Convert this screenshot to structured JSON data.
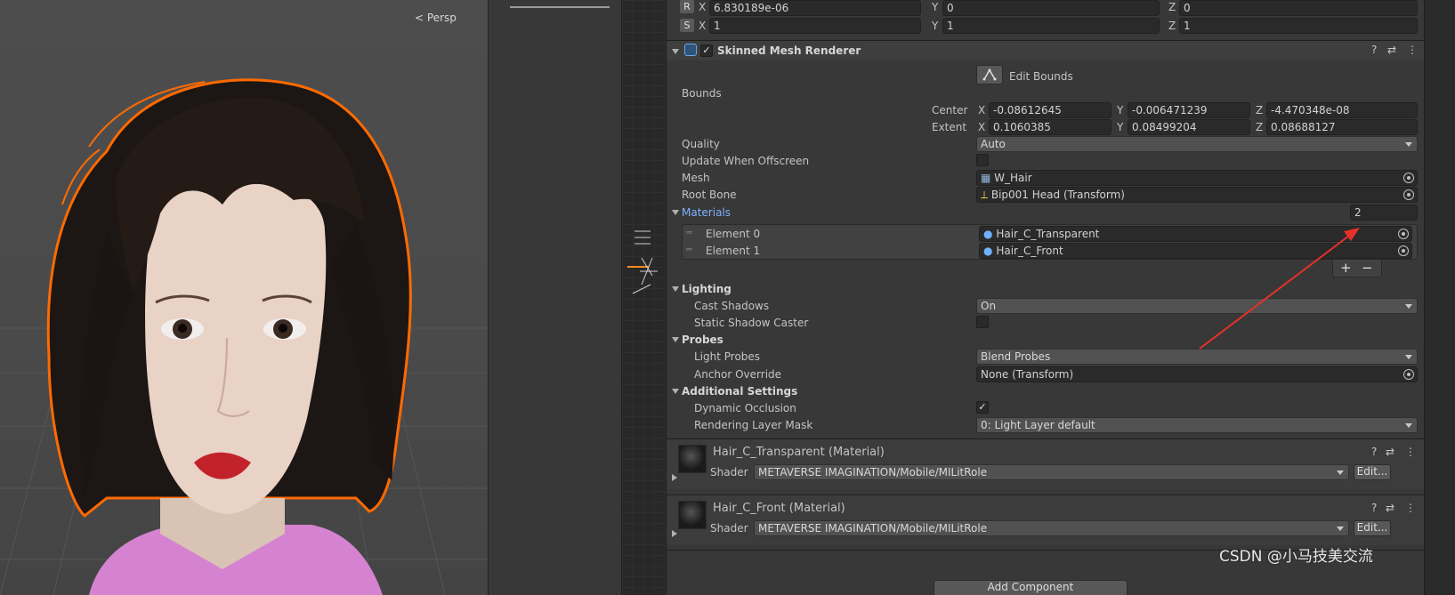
{
  "scene": {
    "view_mode": "Persp"
  },
  "transform": {
    "rotation": {
      "badge": "R",
      "x": "6.830189e-06",
      "y": "0",
      "z": "0"
    },
    "scale": {
      "badge": "S",
      "x": "1",
      "y": "1",
      "z": "1"
    },
    "axes": {
      "x": "X",
      "y": "Y",
      "z": "Z"
    }
  },
  "renderer": {
    "title": "Skinned Mesh Renderer",
    "edit_bounds_label": "Edit Bounds",
    "bounds_label": "Bounds",
    "center_label": "Center",
    "center": {
      "x": "-0.08612645",
      "y": "-0.006471239",
      "z": "-4.470348e-08"
    },
    "extent_label": "Extent",
    "extent": {
      "x": "0.1060385",
      "y": "0.08499204",
      "z": "0.08688127"
    },
    "quality_label": "Quality",
    "quality_value": "Auto",
    "update_offscreen_label": "Update When Offscreen",
    "mesh_label": "Mesh",
    "mesh_value": "W_Hair",
    "root_bone_label": "Root Bone",
    "root_bone_value": "Bip001 Head (Transform)",
    "materials_label": "Materials",
    "materials_count": "2",
    "elements": [
      {
        "label": "Element 0",
        "value": "Hair_C_Transparent"
      },
      {
        "label": "Element 1",
        "value": "Hair_C_Front"
      }
    ],
    "add_label": "+",
    "remove_label": "−",
    "lighting_label": "Lighting",
    "cast_shadows_label": "Cast Shadows",
    "cast_shadows_value": "On",
    "static_shadow_label": "Static Shadow Caster",
    "probes_label": "Probes",
    "light_probes_label": "Light Probes",
    "light_probes_value": "Blend Probes",
    "anchor_override_label": "Anchor Override",
    "anchor_override_value": "None (Transform)",
    "additional_label": "Additional Settings",
    "dynamic_occlusion_label": "Dynamic Occlusion",
    "rendering_layer_label": "Rendering Layer Mask",
    "rendering_layer_value": "0: Light Layer default"
  },
  "materials": [
    {
      "title": "Hair_C_Transparent (Material)",
      "shader_label": "Shader",
      "shader": "METAVERSE IMAGINATION/Mobile/MILitRole",
      "edit": "Edit..."
    },
    {
      "title": "Hair_C_Front (Material)",
      "shader_label": "Shader",
      "shader": "METAVERSE IMAGINATION/Mobile/MILitRole",
      "edit": "Edit..."
    }
  ],
  "add_component_label": "Add Component",
  "watermark": "CSDN @小马技美交流",
  "colors": {
    "highlight_outline": "#ff6a00",
    "annotation_arrow": "#e8302a",
    "materials_header": "#7fb2ff"
  }
}
